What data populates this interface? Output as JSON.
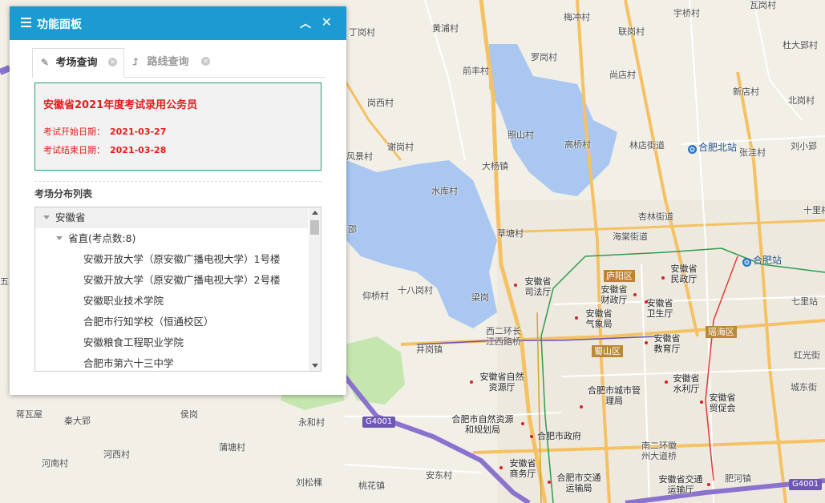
{
  "panel": {
    "title": "功能面板",
    "tabs": [
      {
        "label": "考场查询",
        "icon": "pencil-icon",
        "active": true
      },
      {
        "label": "路线查询",
        "icon": "route-arrow-icon",
        "active": false
      }
    ],
    "exam": {
      "title": "安徽省2021年度考试录用公务员",
      "start_label": "考试开始日期：",
      "start_date": "2021-03-27",
      "end_label": "考试结束日期：",
      "end_date": "2021-03-28"
    },
    "list_title": "考场分布列表",
    "tree": {
      "root": "安徽省",
      "group": "省直(考点数:8)",
      "items": [
        "安徽开放大学（原安徽广播电视大学）1号楼",
        "安徽开放大学（原安徽广播电视大学）2号楼",
        "安徽职业技术学院",
        "合肥市行知学校（恒通校区）",
        "安徽粮食工程职业学院",
        "合肥市第六十三中学"
      ]
    },
    "colors": {
      "header": "#1b9bd1",
      "exam_text": "#e21d1d",
      "exam_border": "#2f9b7a"
    }
  },
  "map": {
    "labels": [
      "瓦岗村",
      "宇桥村",
      "梅冲村",
      "杜大郢村",
      "黄浦村",
      "联岗村",
      "丁岗村",
      "罗岗村",
      "前丰村",
      "尚店村",
      "新店村",
      "北岗村",
      "岗西村",
      "照山村",
      "高桥村",
      "林店街道",
      "张洼村",
      "刘小郢",
      "谢岗村",
      "大杨镇",
      "风景村",
      "水库村",
      "十里村",
      "杏林街道",
      "海棠街道",
      "草塘村",
      "仰桥村",
      "十八岗村",
      "梁岗",
      "七里站",
      "西二环长江西路桥",
      "井岗镇",
      "红光街",
      "城东街",
      "蒋瓦屋",
      "秦大郢",
      "侯岗",
      "永和村",
      "蒲塘村",
      "河西村",
      "河南村",
      "刘松棵",
      "桃花镇",
      "安东村",
      "南二环徽州大道桥",
      "肥河镇",
      "邵",
      "五"
    ],
    "pois": [
      "安徽省民政厅",
      "安徽省司法厅",
      "安徽省财政厅",
      "安徽省气象局",
      "安徽省卫生厅",
      "安徽省教育厅",
      "安徽省自然资源厅",
      "合肥市城市管理局",
      "安徽省水利厅",
      "安徽省贸促会",
      "合肥市自然资源和规划局",
      "合肥市政府",
      "安徽省商务厅",
      "合肥市交通运输局",
      "安徽省交通运输厅"
    ],
    "districts": [
      "庐阳区",
      "瑶海区",
      "蜀山区"
    ],
    "stations": [
      "合肥北站",
      "合肥站"
    ],
    "highways": [
      "G4001",
      "G4001"
    ]
  }
}
